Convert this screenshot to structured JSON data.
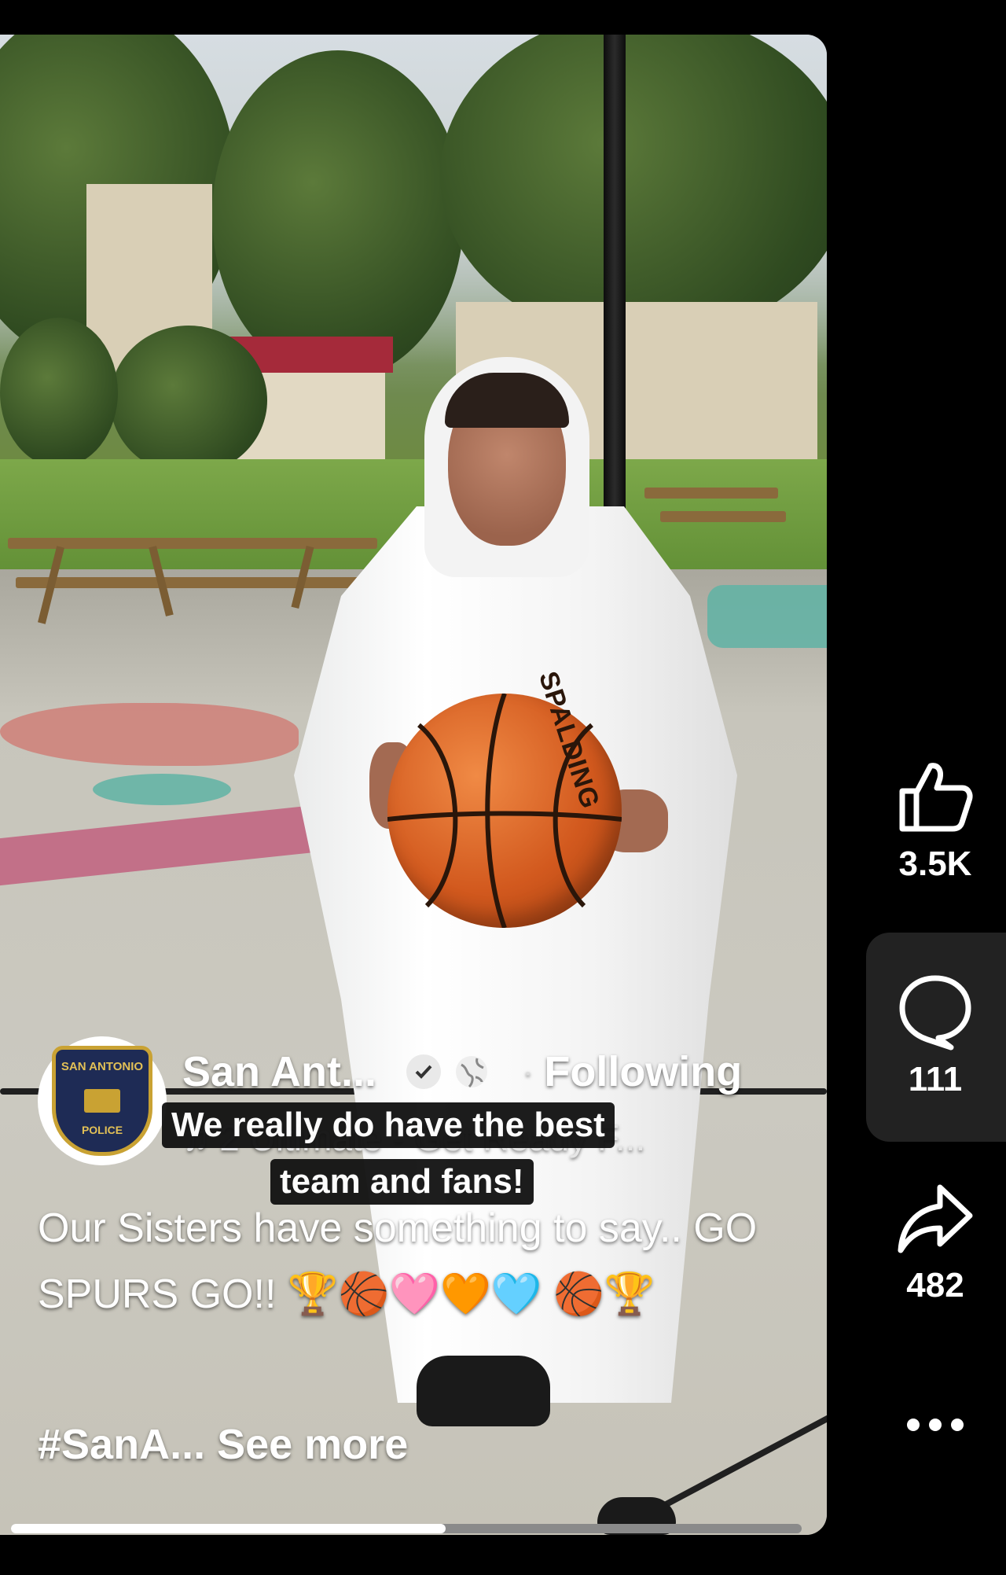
{
  "post": {
    "author": "San Ant...",
    "following_label": "Following",
    "separator": "·",
    "audio": "2 Ultimate - Get Ready F...",
    "overlay_caption_line1": "We really do have the best",
    "overlay_caption_line2": "team and fans!",
    "text": "Our Sisters have something to say.. GO SPURS GO!! 🏆🏀🩷🧡🩵 🏀🏆",
    "hashtag": "#SanA...",
    "see_more": "See more",
    "avatar_badge_top": "SAN ANTONIO",
    "avatar_badge_bottom": "POLICE",
    "ball_brand": "SPALDING",
    "progress_fraction": 0.55
  },
  "actions": {
    "likes": "3.5K",
    "comments": "111",
    "shares": "482"
  },
  "icons": [
    "thumbs-up-icon",
    "comment-icon",
    "share-icon",
    "more-icon",
    "verified-icon",
    "globe-icon",
    "music-icon"
  ]
}
